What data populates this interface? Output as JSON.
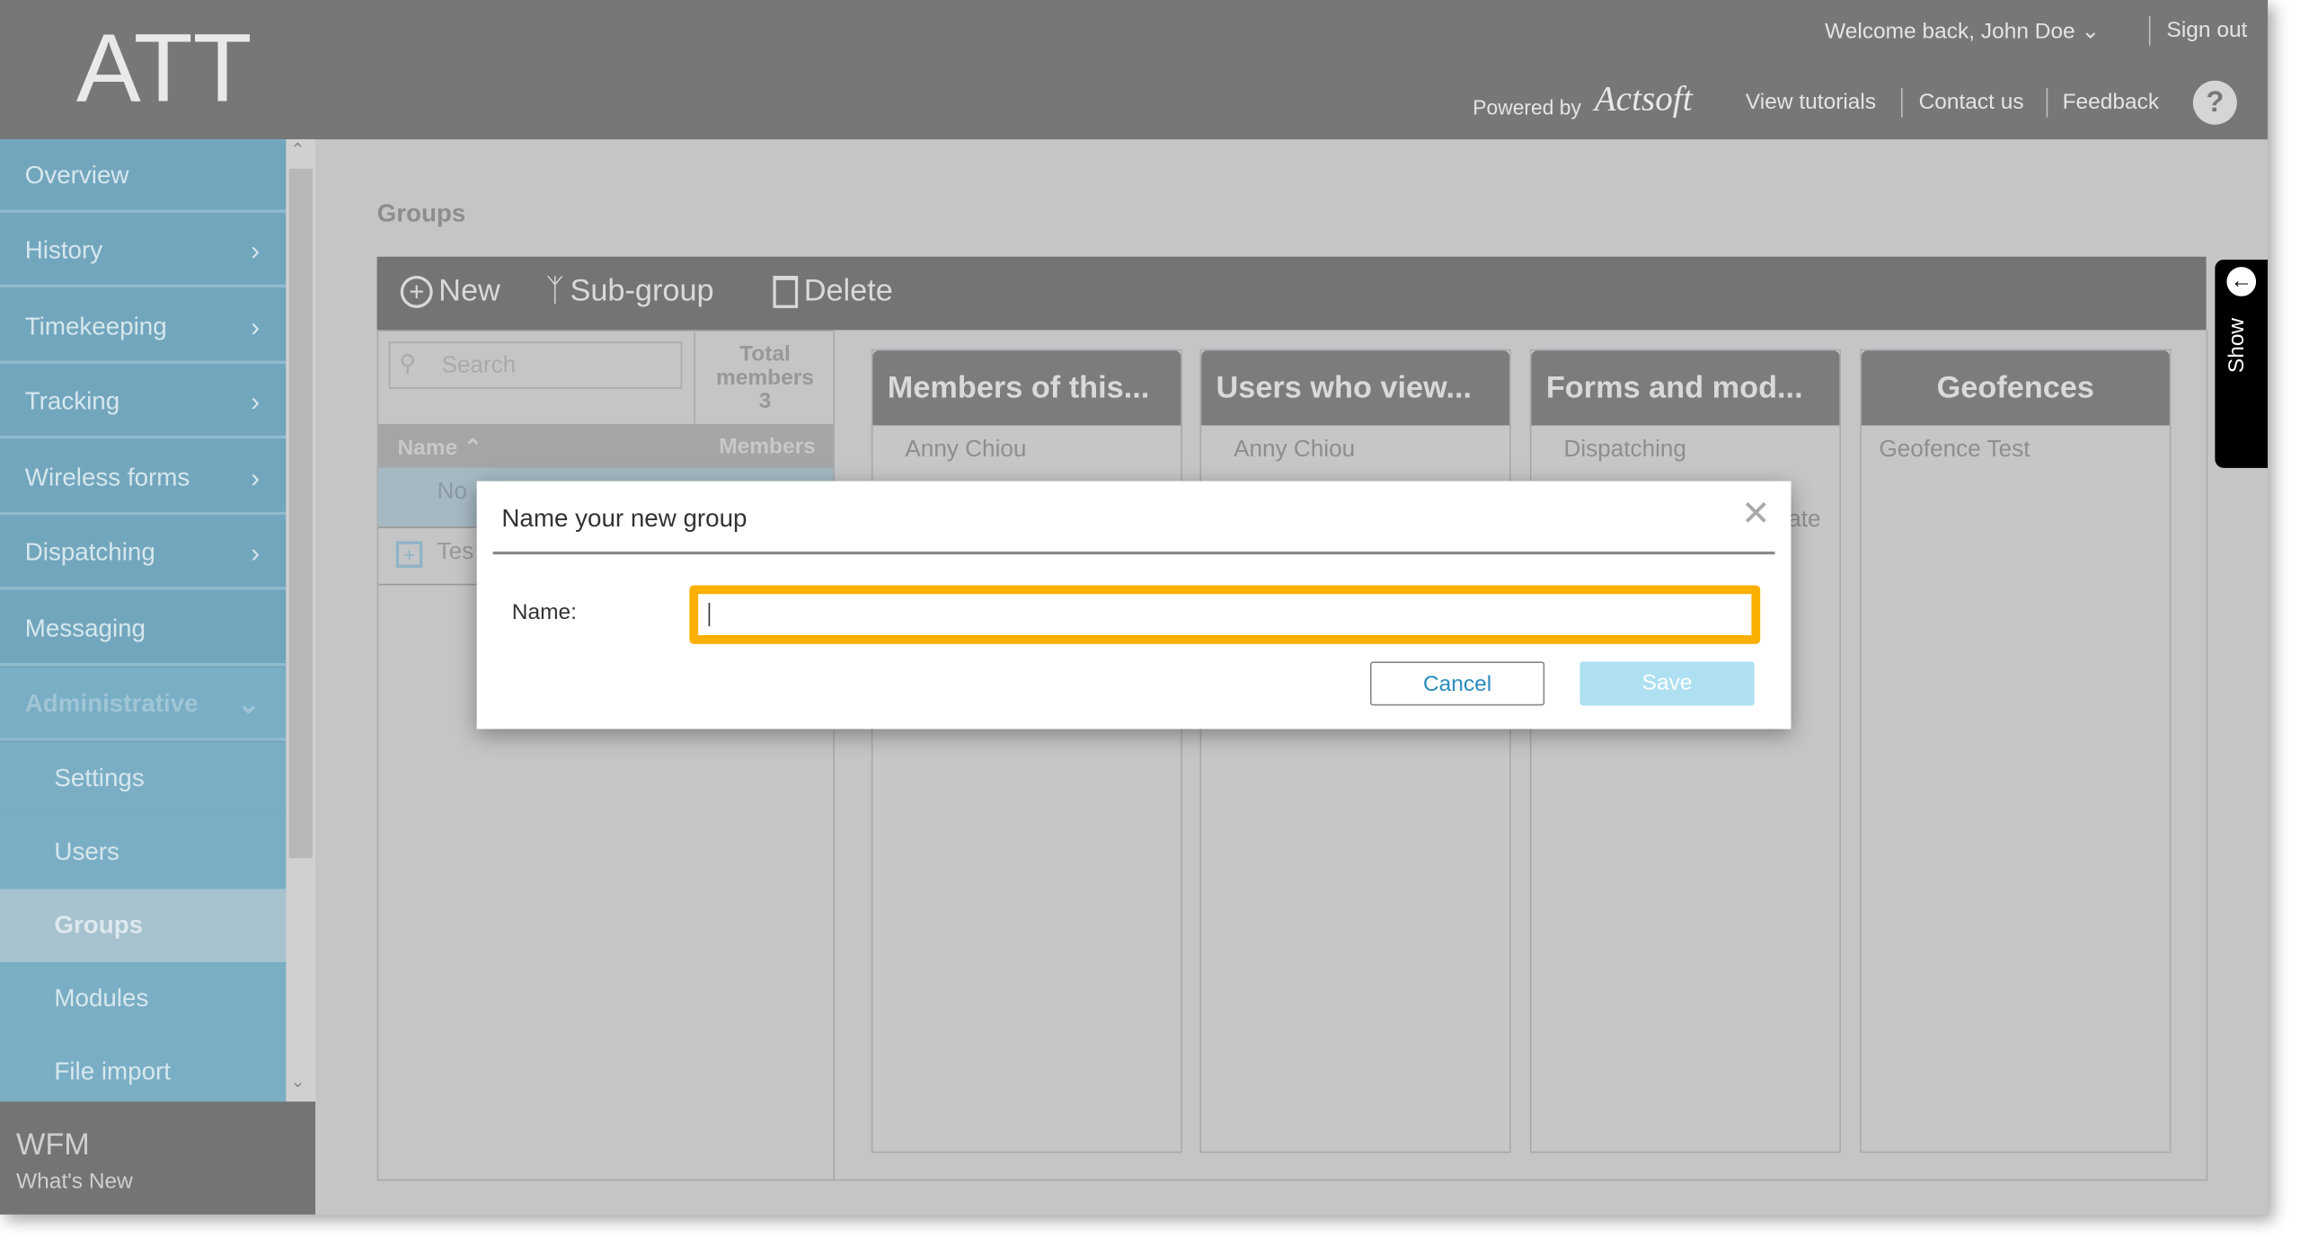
{
  "header": {
    "logo": "ATT",
    "welcome": "Welcome back, John Doe",
    "sign_out": "Sign out",
    "powered_by": "Powered by",
    "brand": "Actsoft",
    "view_tutorials": "View tutorials",
    "contact_us": "Contact us",
    "feedback": "Feedback",
    "help": "?"
  },
  "sidebar": {
    "items": [
      {
        "label": "Overview"
      },
      {
        "label": "History"
      },
      {
        "label": "Timekeeping"
      },
      {
        "label": "Tracking"
      },
      {
        "label": "Wireless forms"
      },
      {
        "label": "Dispatching"
      },
      {
        "label": "Messaging"
      },
      {
        "label": "Administrative"
      }
    ],
    "subitems": [
      {
        "label": "Settings"
      },
      {
        "label": "Users"
      },
      {
        "label": "Groups"
      },
      {
        "label": "Modules"
      },
      {
        "label": "File import"
      }
    ],
    "footer_title": "WFM",
    "footer_link": "What's New"
  },
  "main": {
    "title": "Groups",
    "toolbar": {
      "new": "New",
      "subgroup": "Sub-group",
      "delete": "Delete"
    },
    "search_placeholder": "Search",
    "total_members_label": "Total members",
    "total_members": "3",
    "col_name": "Name",
    "col_members": "Members",
    "rows": [
      "No",
      "Tes"
    ],
    "columns": [
      {
        "title": "Members of this...",
        "items": [
          "Anny Chiou"
        ]
      },
      {
        "title": "Users who view...",
        "items": [
          "Anny Chiou"
        ]
      },
      {
        "title": "Forms and mod...",
        "items": [
          "Dispatching",
          "ate"
        ]
      },
      {
        "title": "Geofences",
        "items": [
          "Geofence Test"
        ]
      }
    ],
    "show_tab": "Show"
  },
  "dialog": {
    "title": "Name your new group",
    "name_label": "Name:",
    "name_value": "",
    "cancel": "Cancel",
    "save": "Save",
    "focus_color": "#fbaf00"
  }
}
